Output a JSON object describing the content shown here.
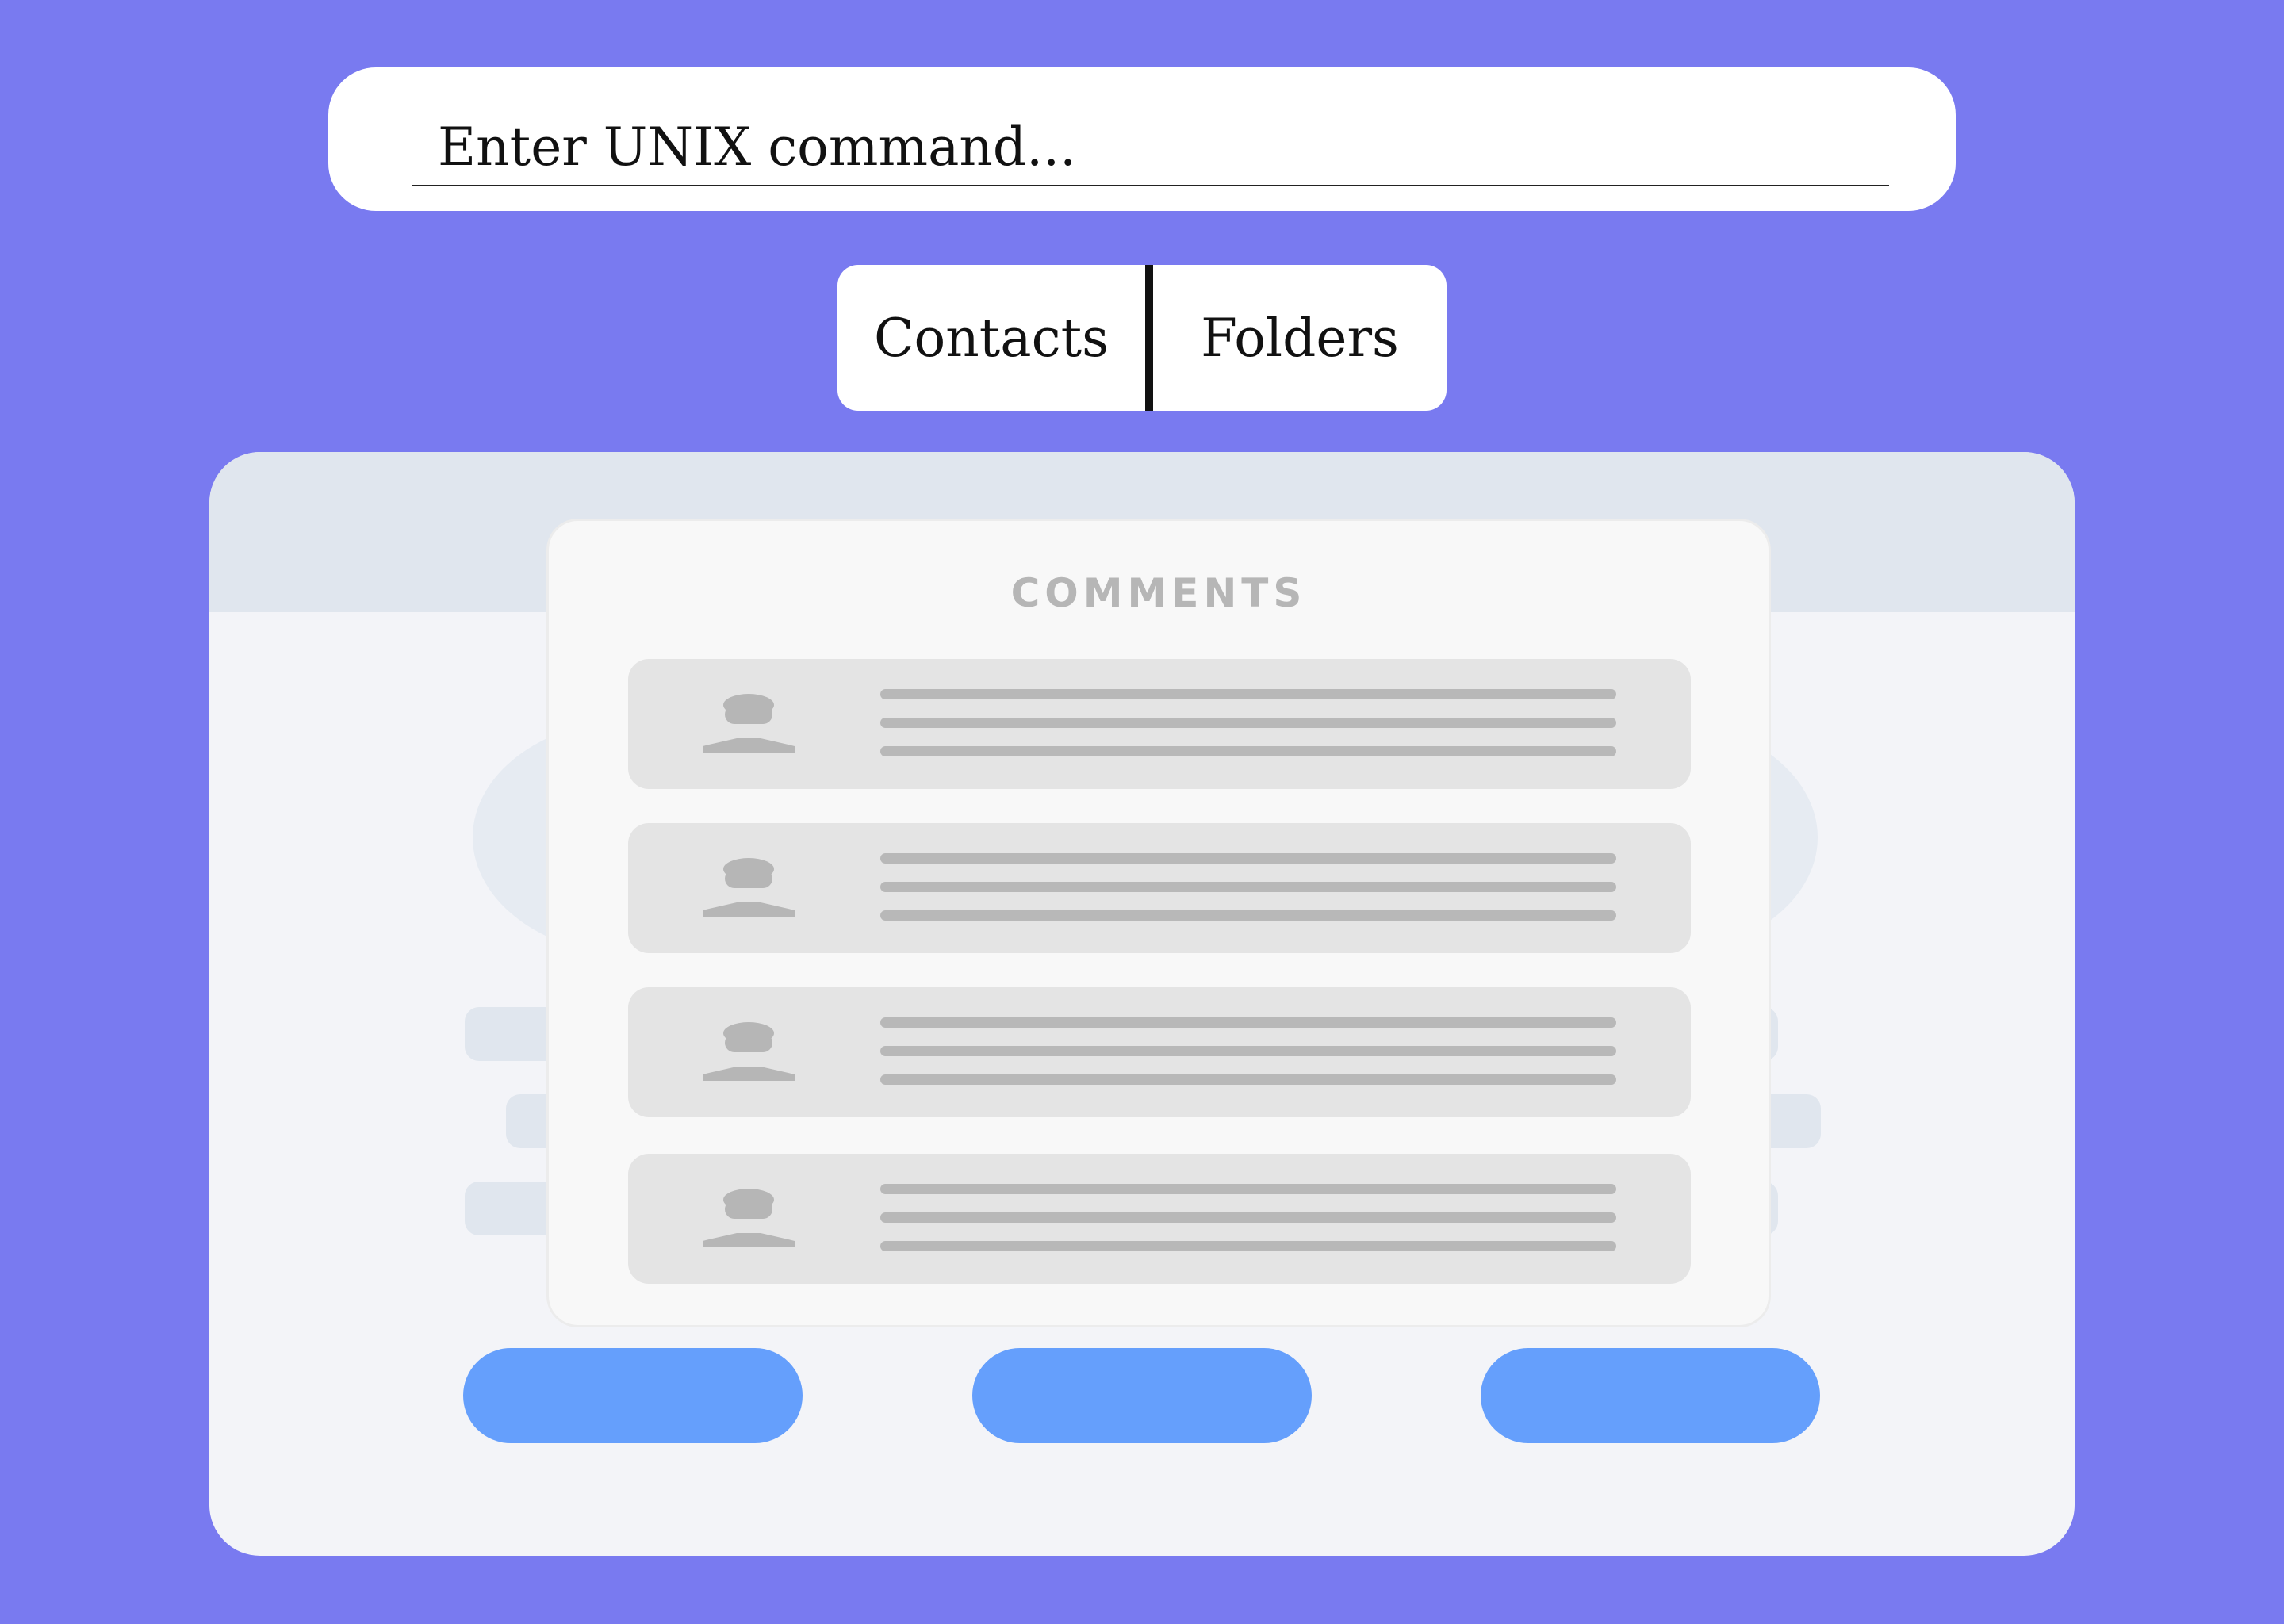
{
  "command_bar": {
    "placeholder": "Enter UNIX command..."
  },
  "tabs": [
    {
      "label": "Contacts"
    },
    {
      "label": "Folders"
    }
  ],
  "comments": {
    "title": "COMMENTS",
    "items_count_visible": 4,
    "avatar_icon": "user-silhouette-icon"
  },
  "colors": {
    "background": "#797af0",
    "pill": "#659ffc",
    "panel": "#f8f8f8",
    "card": "#e4e4e4",
    "placeholder_line": "#b8b8b8"
  }
}
